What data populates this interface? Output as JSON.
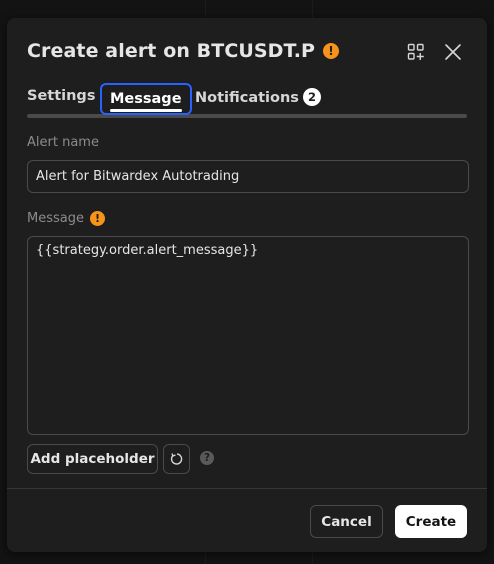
{
  "dialog": {
    "title": "Create alert on BTCUSDT.P",
    "title_warning_icon": "warning-icon",
    "header_icons": [
      "add-widget-icon",
      "close-icon"
    ]
  },
  "tabs": [
    {
      "label": "Settings",
      "active": false
    },
    {
      "label": "Message",
      "active": true
    },
    {
      "label": "Notifications",
      "active": false,
      "badge": "2"
    }
  ],
  "form": {
    "alert_name_label": "Alert name",
    "alert_name_value": "Alert for Bitwardex Autotrading",
    "message_label": "Message",
    "message_value": "{{strategy.order.alert_message}}",
    "add_placeholder_label": "Add placeholder",
    "reset_icon": "reset-icon",
    "help_icon": "help-icon",
    "help_glyph": "?"
  },
  "footer": {
    "cancel_label": "Cancel",
    "create_label": "Create"
  },
  "colors": {
    "accent": "#2962ff",
    "warning": "#f7931a",
    "background": "#1e1e1e"
  }
}
